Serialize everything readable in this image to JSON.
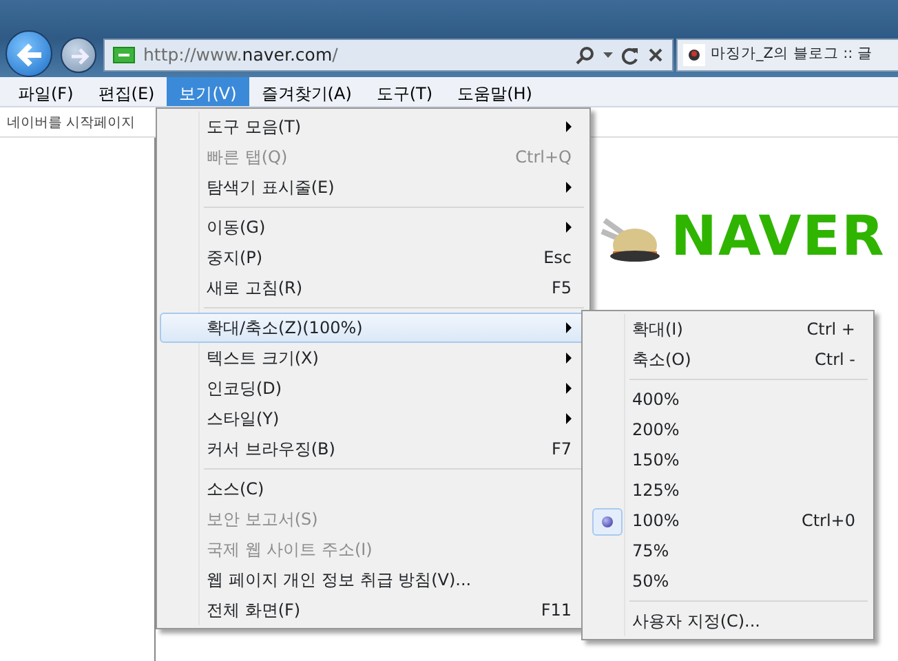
{
  "address_bar": {
    "url_prefix": "http://www.",
    "url_domain": "naver.com",
    "url_suffix": "/"
  },
  "tab": {
    "title": "마징가_Z의 블로그 :: 글"
  },
  "menu_bar": [
    {
      "label": "파일(F)",
      "selected": false
    },
    {
      "label": "편집(E)",
      "selected": false
    },
    {
      "label": "보기(V)",
      "selected": true
    },
    {
      "label": "즐겨찾기(A)",
      "selected": false
    },
    {
      "label": "도구(T)",
      "selected": false
    },
    {
      "label": "도움말(H)",
      "selected": false
    }
  ],
  "info_bar": {
    "text": "네이버를 시작페이지"
  },
  "page": {
    "logo": "NAVER"
  },
  "view_menu": [
    {
      "kind": "item",
      "label": "도구 모음(T)",
      "disabled": false,
      "submenu": true,
      "selected": false
    },
    {
      "kind": "item",
      "label": "빠른 탭(Q)",
      "shortcut": "Ctrl+Q",
      "disabled": true,
      "submenu": false,
      "selected": false
    },
    {
      "kind": "item",
      "label": "탐색기 표시줄(E)",
      "disabled": false,
      "submenu": true,
      "selected": false
    },
    {
      "kind": "separator"
    },
    {
      "kind": "item",
      "label": "이동(G)",
      "disabled": false,
      "submenu": true,
      "selected": false
    },
    {
      "kind": "item",
      "label": "중지(P)",
      "shortcut": "Esc",
      "disabled": false,
      "submenu": false,
      "selected": false
    },
    {
      "kind": "item",
      "label": "새로 고침(R)",
      "shortcut": "F5",
      "disabled": false,
      "submenu": false,
      "selected": false
    },
    {
      "kind": "separator"
    },
    {
      "kind": "item",
      "label": "확대/축소(Z)(100%)",
      "disabled": false,
      "submenu": true,
      "selected": true
    },
    {
      "kind": "item",
      "label": "텍스트 크기(X)",
      "disabled": false,
      "submenu": true,
      "selected": false
    },
    {
      "kind": "item",
      "label": "인코딩(D)",
      "disabled": false,
      "submenu": true,
      "selected": false
    },
    {
      "kind": "item",
      "label": "스타일(Y)",
      "disabled": false,
      "submenu": true,
      "selected": false
    },
    {
      "kind": "item",
      "label": "커서 브라우징(B)",
      "shortcut": "F7",
      "disabled": false,
      "submenu": false,
      "selected": false
    },
    {
      "kind": "separator"
    },
    {
      "kind": "item",
      "label": "소스(C)",
      "disabled": false,
      "submenu": false,
      "selected": false
    },
    {
      "kind": "item",
      "label": "보안 보고서(S)",
      "disabled": true,
      "submenu": false,
      "selected": false
    },
    {
      "kind": "item",
      "label": "국제 웹 사이트 주소(I)",
      "disabled": true,
      "submenu": false,
      "selected": false
    },
    {
      "kind": "item",
      "label": "웹 페이지 개인 정보 취급 방침(V)...",
      "disabled": false,
      "submenu": false,
      "selected": false
    },
    {
      "kind": "item",
      "label": "전체 화면(F)",
      "shortcut": "F11",
      "disabled": false,
      "submenu": false,
      "selected": false
    }
  ],
  "zoom_menu": [
    {
      "kind": "item",
      "label": "확대(I)",
      "shortcut": "Ctrl +",
      "checked": false
    },
    {
      "kind": "item",
      "label": "축소(O)",
      "shortcut": "Ctrl -",
      "checked": false
    },
    {
      "kind": "separator"
    },
    {
      "kind": "item",
      "label": "400%",
      "checked": false
    },
    {
      "kind": "item",
      "label": "200%",
      "checked": false
    },
    {
      "kind": "item",
      "label": "150%",
      "checked": false
    },
    {
      "kind": "item",
      "label": "125%",
      "checked": false
    },
    {
      "kind": "item",
      "label": "100%",
      "shortcut": "Ctrl+0",
      "checked": true
    },
    {
      "kind": "item",
      "label": "75%",
      "checked": false
    },
    {
      "kind": "item",
      "label": "50%",
      "checked": false
    },
    {
      "kind": "separator"
    },
    {
      "kind": "item",
      "label": "사용자 지정(C)...",
      "checked": false
    }
  ]
}
